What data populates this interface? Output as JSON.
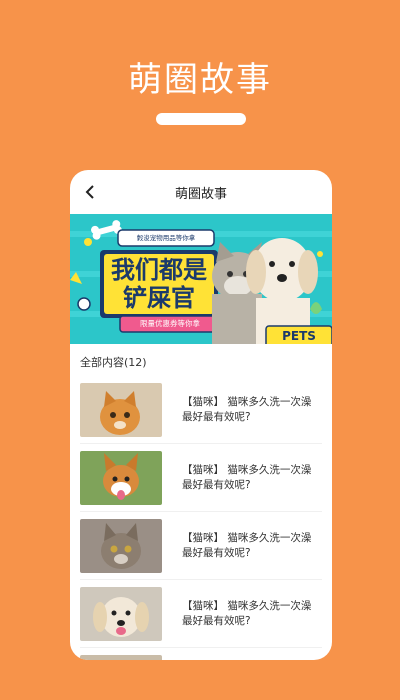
{
  "promo": {
    "title": "萌圈故事"
  },
  "nav": {
    "title": "萌圈故事"
  },
  "banner": {
    "top_tag": "榖浚宠物用品等你拿",
    "headline_line1": "我们都是",
    "headline_line2": "铲屎官",
    "bottom_tag": "限量优惠券等你拿",
    "sign": "PETS"
  },
  "section": {
    "heading": "全部内容(12)"
  },
  "articles": [
    {
      "title": "【猫咪】 猫咪多久洗一次澡最好最有效呢?",
      "image": "kitten"
    },
    {
      "title": "【猫咪】 猫咪多久洗一次澡最好最有效呢?",
      "image": "corgi"
    },
    {
      "title": "【猫咪】 猫咪多久洗一次澡最好最有效呢?",
      "image": "tabby-cat"
    },
    {
      "title": "【猫咪】 猫咪多久洗一次澡最好最有效呢?",
      "image": "retriever"
    }
  ],
  "colors": {
    "background": "#F7934A",
    "banner_teal": "#2CC6C9",
    "banner_yellow": "#FFE236",
    "banner_pink": "#F05A8E"
  }
}
